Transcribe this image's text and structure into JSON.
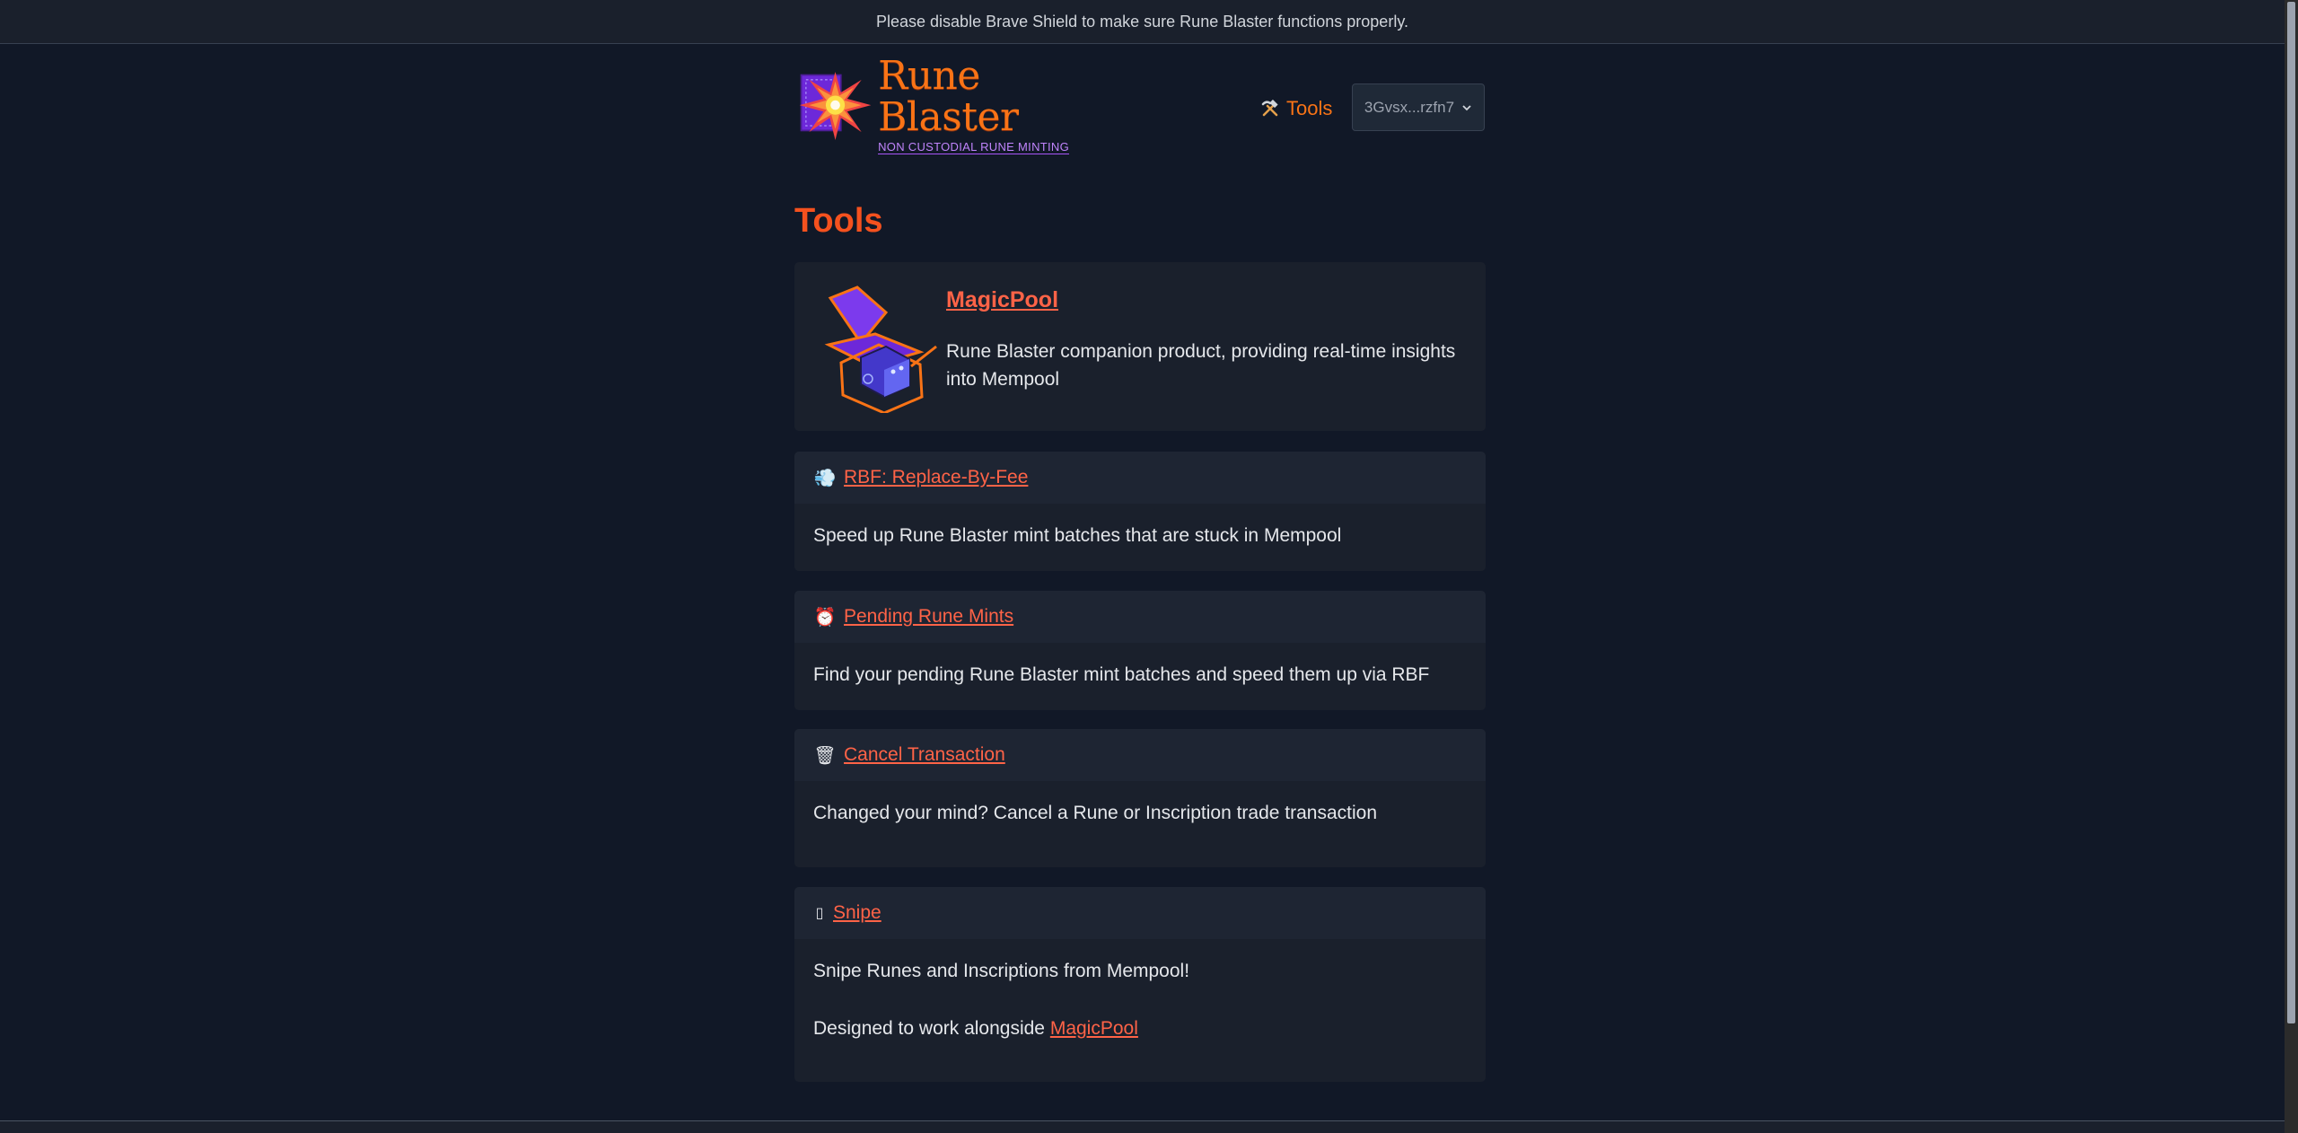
{
  "banner": {
    "text": "Please disable Brave Shield to make sure Rune Blaster functions properly."
  },
  "header": {
    "logo_title": "Rune Blaster",
    "logo_subtitle": "NON CUSTODIAL RUNE MINTING",
    "nav_tools_icon": "hammer-pick-icon",
    "nav_tools_label": "Tools",
    "wallet_address": "3Gvsx...rzfn7",
    "wallet_caret": "⌄"
  },
  "page": {
    "title": "Tools"
  },
  "cards": {
    "magicpool": {
      "title": "MagicPool",
      "description": "Rune Blaster companion product, providing real-time insights into Mempool"
    },
    "rbf": {
      "icon": "💨",
      "title": "RBF: Replace-By-Fee",
      "description": "Speed up Rune Blaster mint batches that are stuck in Mempool"
    },
    "pending": {
      "icon": "⏰",
      "title": "Pending Rune Mints",
      "description": "Find your pending Rune Blaster mint batches and speed them up via RBF"
    },
    "cancel": {
      "icon": "🗑",
      "title": "Cancel Transaction",
      "description": "Changed your mind? Cancel a Rune or Inscription trade transaction"
    },
    "snipe": {
      "icon": "▯",
      "title": "Snipe",
      "description": "Snipe Runes and Inscriptions from Mempool!",
      "note_prefix": "Designed to work alongside ",
      "note_link": "MagicPool"
    }
  },
  "colors": {
    "accent": "#f4511e",
    "link": "#ff6347",
    "background": "#111827",
    "card": "#1a202c"
  }
}
